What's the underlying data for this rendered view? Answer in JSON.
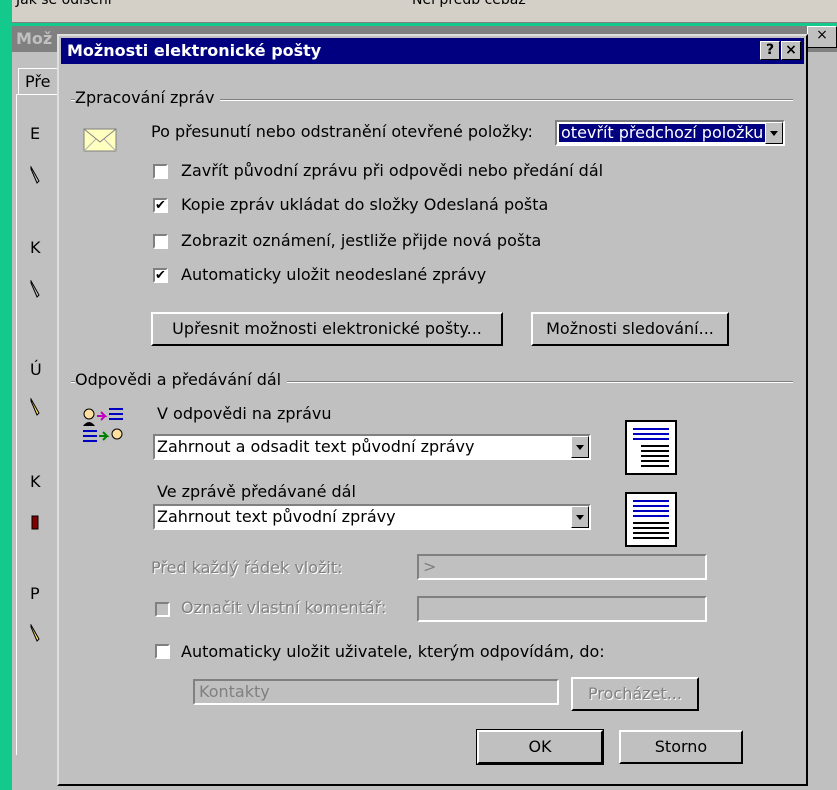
{
  "background": {
    "top_strip_left": "Jak se odlšení",
    "top_strip_right": "Nel předb čebaž",
    "window_title": "Mož",
    "tab_label": "Pře",
    "side_letters": [
      "E",
      "K",
      "Ú",
      "K",
      "P"
    ],
    "right_button": "×"
  },
  "dialog": {
    "title": "Možnosti elektronické pošty",
    "help_button": "?",
    "close_button": "×",
    "processing": {
      "group_title": "Zpracování zpráv",
      "after_move_label": "Po přesunutí nebo odstranění otevřené položky:",
      "after_move_value": "otevřít předchozí položku",
      "checkboxes": [
        {
          "label": "Zavřít původní zprávu při odpovědi nebo předání dál",
          "checked": false,
          "mark": ""
        },
        {
          "label": "Kopie zpráv ukládat do složky Odeslaná pošta",
          "checked": true,
          "mark": "✔"
        },
        {
          "label": "Zobrazit oznámení, jestliže přijde nová pošta",
          "checked": false,
          "mark": ""
        },
        {
          "label": "Automaticky uložit neodeslané zprávy",
          "checked": true,
          "mark": "✔"
        }
      ],
      "advanced_button": "Upřesnit možnosti elektronické pošty...",
      "tracking_button": "Možnosti sledování..."
    },
    "replies": {
      "group_title": "Odpovědi a předávání dál",
      "reply_label": "V odpovědi na zprávu",
      "reply_value": "Zahrnout a odsadit text původní zprávy",
      "forward_label": "Ve zprávě předávané dál",
      "forward_value": "Zahrnout text původní zprávy",
      "prefix_label": "Před každý řádek vložit:",
      "prefix_value": ">",
      "mark_comments_label": "Označit vlastní komentář:",
      "mark_comments_value": "",
      "auto_save_label": "Automaticky uložit uživatele, kterým odpovídám, do:",
      "auto_save_checked": false,
      "contacts_value": "Kontakty",
      "browse_button": "Procházet..."
    },
    "ok_button": "OK",
    "cancel_button": "Storno"
  }
}
